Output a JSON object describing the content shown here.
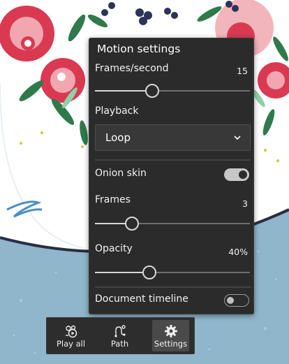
{
  "panel": {
    "title": "Motion settings",
    "frames_per_second": {
      "label": "Frames/second",
      "value": "15",
      "level": 0.37
    },
    "playback": {
      "label": "Playback",
      "selected": "Loop",
      "icon": "chevron-down-icon"
    },
    "onion_skin": {
      "label": "Onion skin",
      "on": true
    },
    "frames": {
      "label": "Frames",
      "value": "3",
      "level": 0.24
    },
    "opacity": {
      "label": "Opacity",
      "value": "40%",
      "level": 0.35
    },
    "document_timeline": {
      "label": "Document timeline",
      "on": false
    }
  },
  "toolbar": {
    "items": [
      {
        "label": "Play all",
        "icon": "play-all-icon",
        "active": false
      },
      {
        "label": "Path",
        "icon": "path-icon",
        "active": false
      },
      {
        "label": "Settings",
        "icon": "gear-icon",
        "active": true
      }
    ]
  },
  "colors": {
    "panel_bg": "#2b2b2b",
    "canvas_blue": "#8fb6cb",
    "rose_red": "#d93a52",
    "leaf_green": "#2f7a4c"
  }
}
